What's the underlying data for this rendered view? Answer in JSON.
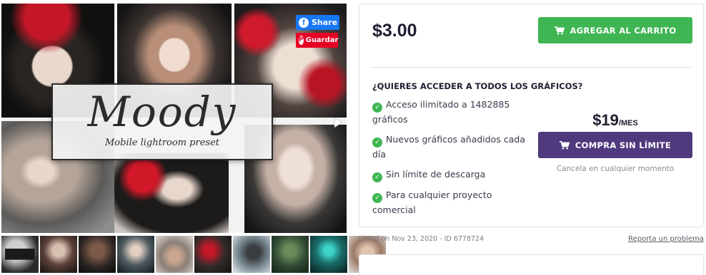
{
  "gallery": {
    "brand_title": "Moody",
    "brand_subtitle": "Mobile lightroom preset",
    "share_label": "Share",
    "save_label": "Guardar",
    "thumbnail_count": 10
  },
  "product": {
    "price": "$3.00",
    "add_to_cart_label": "AGREGAR AL CARRITO"
  },
  "promo": {
    "title": "¿QUIERES ACCEDER A TODOS LOS GRÁFICOS?",
    "features": [
      "Acceso ilimitado a 1482885 gráficos",
      "Nuevos gráficos añadidos cada día",
      "Sin límite de descarga",
      "Para cualquier proyecto comercial"
    ],
    "subscription_price": "$19",
    "subscription_period": "/MES",
    "unlimited_button_label": "COMPRA SIN LÍMITE",
    "cancel_note": "Cancela en cualquier momento"
  },
  "meta": {
    "listed_text": "Listed on Nov 23, 2020 - ID 6778724",
    "report_link": "Reporta un problema"
  },
  "colors": {
    "add_to_cart": "#3fb653",
    "unlimited": "#4f3a7e",
    "facebook": "#1877f2",
    "pinterest": "#e60023"
  }
}
